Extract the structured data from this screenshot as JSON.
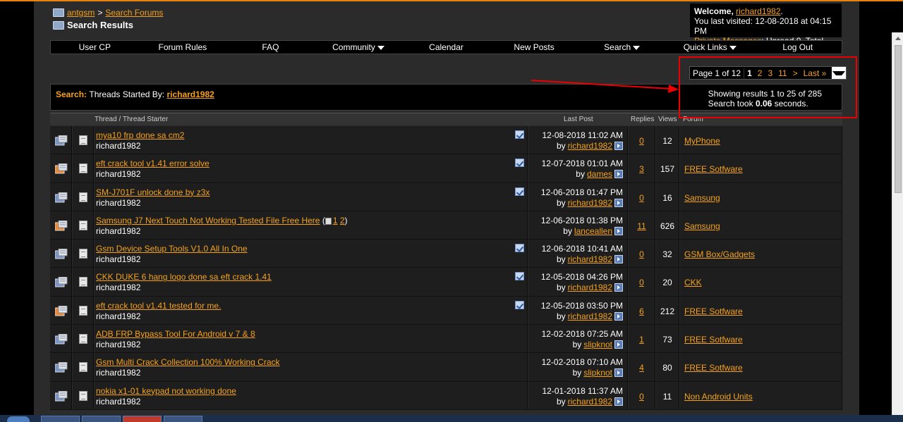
{
  "breadcrumb": {
    "site": "antgsm",
    "separator": ">",
    "section": "Search Forums",
    "current": "Search Results"
  },
  "welcome": {
    "greeting": "Welcome,",
    "username": "richard1982",
    "punct": ".",
    "last_visited": "You last visited: 12-08-2018 at 04:15 PM",
    "pm_label": "Private Messages",
    "pm_counts": ": Unread 0, Total 725."
  },
  "navbar": {
    "items": [
      "User CP",
      "Forum Rules",
      "FAQ",
      "Community",
      "Calendar",
      "New Posts",
      "Search",
      "Quick Links",
      "Log Out"
    ]
  },
  "pager": {
    "label": "Page 1 of 12",
    "current": "1",
    "pages": [
      "2",
      "3",
      "11"
    ],
    "next": ">",
    "last": "Last »"
  },
  "search": {
    "prefix": "Search:",
    "query_text": "Threads Started By:",
    "query_user": "richard1982",
    "results_line": "Showing results 1 to 25 of 285",
    "time_prefix": "Search took ",
    "time_value": "0.06",
    "time_suffix": " seconds."
  },
  "table": {
    "headers": {
      "thread": "Thread / Thread Starter",
      "last_post": "Last Post",
      "replies": "Replies",
      "views": "Views",
      "forum": "Forum"
    },
    "rows": [
      {
        "title": "mya10 frp done sa cm2",
        "starter": "richard1982",
        "date": "12-08-2018 11:02 AM",
        "by": "richard1982",
        "replies": "0",
        "views": "12",
        "forum": "MyPhone",
        "hot": false,
        "check": true
      },
      {
        "title": "eft crack tool v1.41 error solve",
        "starter": "richard1982",
        "date": "12-07-2018 01:01 AM",
        "by": "dames",
        "replies": "3",
        "views": "157",
        "forum": "FREE Sotfware",
        "hot": true,
        "check": true
      },
      {
        "title": "SM-J701F unlock done by z3x",
        "starter": "richard1982",
        "date": "12-06-2018 01:47 PM",
        "by": "richard1982",
        "replies": "0",
        "views": "16",
        "forum": "Samsung",
        "hot": false,
        "check": true
      },
      {
        "title": "Samsung J7 Next Touch Not Working Tested File Free Here",
        "starter": "richard1982",
        "date": "12-06-2018 01:38 PM",
        "by": "lanceallen",
        "replies": "11",
        "views": "626",
        "forum": "Samsung",
        "hot": true,
        "check": false,
        "pages": [
          "1",
          "2"
        ]
      },
      {
        "title": "Gsm Device Setup Tools V1.0 All In One",
        "starter": "richard1982",
        "date": "12-06-2018 10:41 AM",
        "by": "richard1982",
        "replies": "0",
        "views": "32",
        "forum": "GSM Box/Gadgets",
        "hot": false,
        "check": true
      },
      {
        "title": "CKK DUKE 6 hang logo done sa eft crack 1.41",
        "starter": "richard1982",
        "date": "12-05-2018 04:26 PM",
        "by": "richard1982",
        "replies": "0",
        "views": "20",
        "forum": "CKK",
        "hot": false,
        "check": true
      },
      {
        "title": "eft crack tool v1.41 tested for me.",
        "starter": "richard1982",
        "date": "12-05-2018 03:50 PM",
        "by": "richard1982",
        "replies": "6",
        "views": "212",
        "forum": "FREE Sotfware",
        "hot": true,
        "check": true
      },
      {
        "title": "ADB FRP Bypass Tool For Android v 7 & 8",
        "starter": "richard1982",
        "date": "12-02-2018 07:25 AM",
        "by": "slipknot",
        "replies": "1",
        "views": "73",
        "forum": "FREE Sotfware",
        "hot": false,
        "check": false
      },
      {
        "title": "Gsm Multi Crack Collection 100% Working Crack",
        "starter": "richard1982",
        "date": "12-02-2018 07:10 AM",
        "by": "slipknot",
        "replies": "4",
        "views": "80",
        "forum": "FREE Sotfware",
        "hot": false,
        "check": false
      },
      {
        "title": "nokia x1-01 keypad not working done",
        "starter": "richard1982",
        "date": "12-01-2018 11:37 AM",
        "by": "richard1982",
        "replies": "0",
        "views": "11",
        "forum": "Non Android Units",
        "hot": false,
        "check": false
      }
    ]
  },
  "by_prefix": "by",
  "colors": {
    "accent": "#f5a21b",
    "background": "#2b2b2b",
    "annotation": "#ee0000"
  }
}
